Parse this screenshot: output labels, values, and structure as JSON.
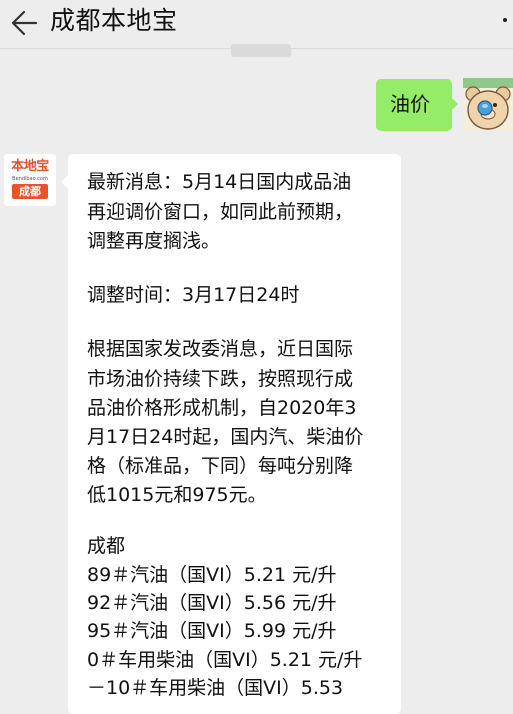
{
  "header": {
    "title": "成都本地宝"
  },
  "user_message": {
    "text": "油价"
  },
  "bot_avatar": {
    "logo_text": "本地宝",
    "logo_url": "Bendibao.com",
    "logo_city": "成都"
  },
  "bot_message": {
    "lines": [
      "最新消息：5月14日国内成品油",
      "再迎调价窗口，如同此前预期，",
      "调整再度搁浅。",
      "调整时间：3月17日24时",
      "根据国家发改委消息，近日国际",
      "市场油价持续下跌，按照现行成",
      "品油价格形成机制，自2020年3",
      "月17日24时起，国内汽、柴油价",
      "格（标准品，下同）每吨分别降",
      "低1015元和975元。",
      "成都",
      "89＃汽油（国VI）5.21 元/升",
      "92＃汽油（国VI）5.56 元/升",
      "95＃汽油（国VI）5.99 元/升",
      "0＃车用柴油（国VI）5.21 元/升",
      "－10＃车用柴油（国VI）5.53"
    ]
  }
}
